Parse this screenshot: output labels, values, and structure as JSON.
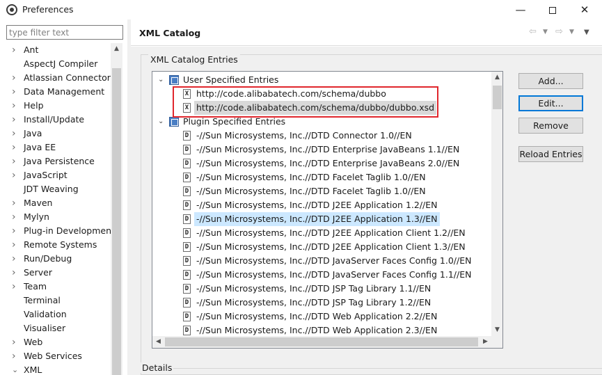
{
  "window": {
    "title": "Preferences",
    "minimize": "—",
    "close": "✕"
  },
  "filter": {
    "placeholder": "type filter text",
    "value": ""
  },
  "preferences": [
    {
      "label": "Ant",
      "expandable": true
    },
    {
      "label": "AspectJ Compiler",
      "expandable": false
    },
    {
      "label": "Atlassian Connector",
      "expandable": true
    },
    {
      "label": "Data Management",
      "expandable": true
    },
    {
      "label": "Help",
      "expandable": true
    },
    {
      "label": "Install/Update",
      "expandable": true
    },
    {
      "label": "Java",
      "expandable": true
    },
    {
      "label": "Java EE",
      "expandable": true
    },
    {
      "label": "Java Persistence",
      "expandable": true
    },
    {
      "label": "JavaScript",
      "expandable": true
    },
    {
      "label": "JDT Weaving",
      "expandable": false
    },
    {
      "label": "Maven",
      "expandable": true
    },
    {
      "label": "Mylyn",
      "expandable": true
    },
    {
      "label": "Plug-in Development",
      "expandable": true
    },
    {
      "label": "Remote Systems",
      "expandable": true
    },
    {
      "label": "Run/Debug",
      "expandable": true
    },
    {
      "label": "Server",
      "expandable": true
    },
    {
      "label": "Team",
      "expandable": true
    },
    {
      "label": "Terminal",
      "expandable": false
    },
    {
      "label": "Validation",
      "expandable": false
    },
    {
      "label": "Visualiser",
      "expandable": false
    },
    {
      "label": "Web",
      "expandable": true
    },
    {
      "label": "Web Services",
      "expandable": true
    },
    {
      "label": "XML",
      "expandable": true,
      "expanded": true
    }
  ],
  "page": {
    "title": "XML Catalog",
    "group_label": "XML Catalog Entries",
    "details_label": "Details"
  },
  "catalog": {
    "user_label": "User Specified Entries",
    "user_entries": [
      "http://code.alibabatech.com/schema/dubbo",
      "http://code.alibabatech.com/schema/dubbo/dubbo.xsd"
    ],
    "plugin_label": "Plugin Specified Entries",
    "plugin_entries": [
      "-//Sun Microsystems, Inc.//DTD Connector 1.0//EN",
      "-//Sun Microsystems, Inc.//DTD Enterprise JavaBeans 1.1//EN",
      "-//Sun Microsystems, Inc.//DTD Enterprise JavaBeans 2.0//EN",
      "-//Sun Microsystems, Inc.//DTD Facelet Taglib 1.0//EN",
      "-//Sun Microsystems, Inc.//DTD Facelet Taglib 1.0//EN",
      "-//Sun Microsystems, Inc.//DTD J2EE Application 1.2//EN",
      "-//Sun Microsystems, Inc.//DTD J2EE Application 1.3//EN",
      "-//Sun Microsystems, Inc.//DTD J2EE Application Client 1.2//EN",
      "-//Sun Microsystems, Inc.//DTD J2EE Application Client 1.3//EN",
      "-//Sun Microsystems, Inc.//DTD JavaServer Faces Config 1.0//EN",
      "-//Sun Microsystems, Inc.//DTD JavaServer Faces Config 1.1//EN",
      "-//Sun Microsystems, Inc.//DTD JSP Tag Library 1.1//EN",
      "-//Sun Microsystems, Inc.//DTD JSP Tag Library 1.2//EN",
      "-//Sun Microsystems, Inc.//DTD Web Application 2.2//EN",
      "-//Sun Microsystems, Inc.//DTD Web Application 2.3//EN"
    ]
  },
  "buttons": {
    "add": "Add...",
    "edit": "Edit...",
    "remove": "Remove",
    "reload": "Reload Entries"
  },
  "colors": {
    "highlight_box": "#e0262c",
    "selection": "#cce8ff",
    "default_button_border": "#0078d7"
  }
}
